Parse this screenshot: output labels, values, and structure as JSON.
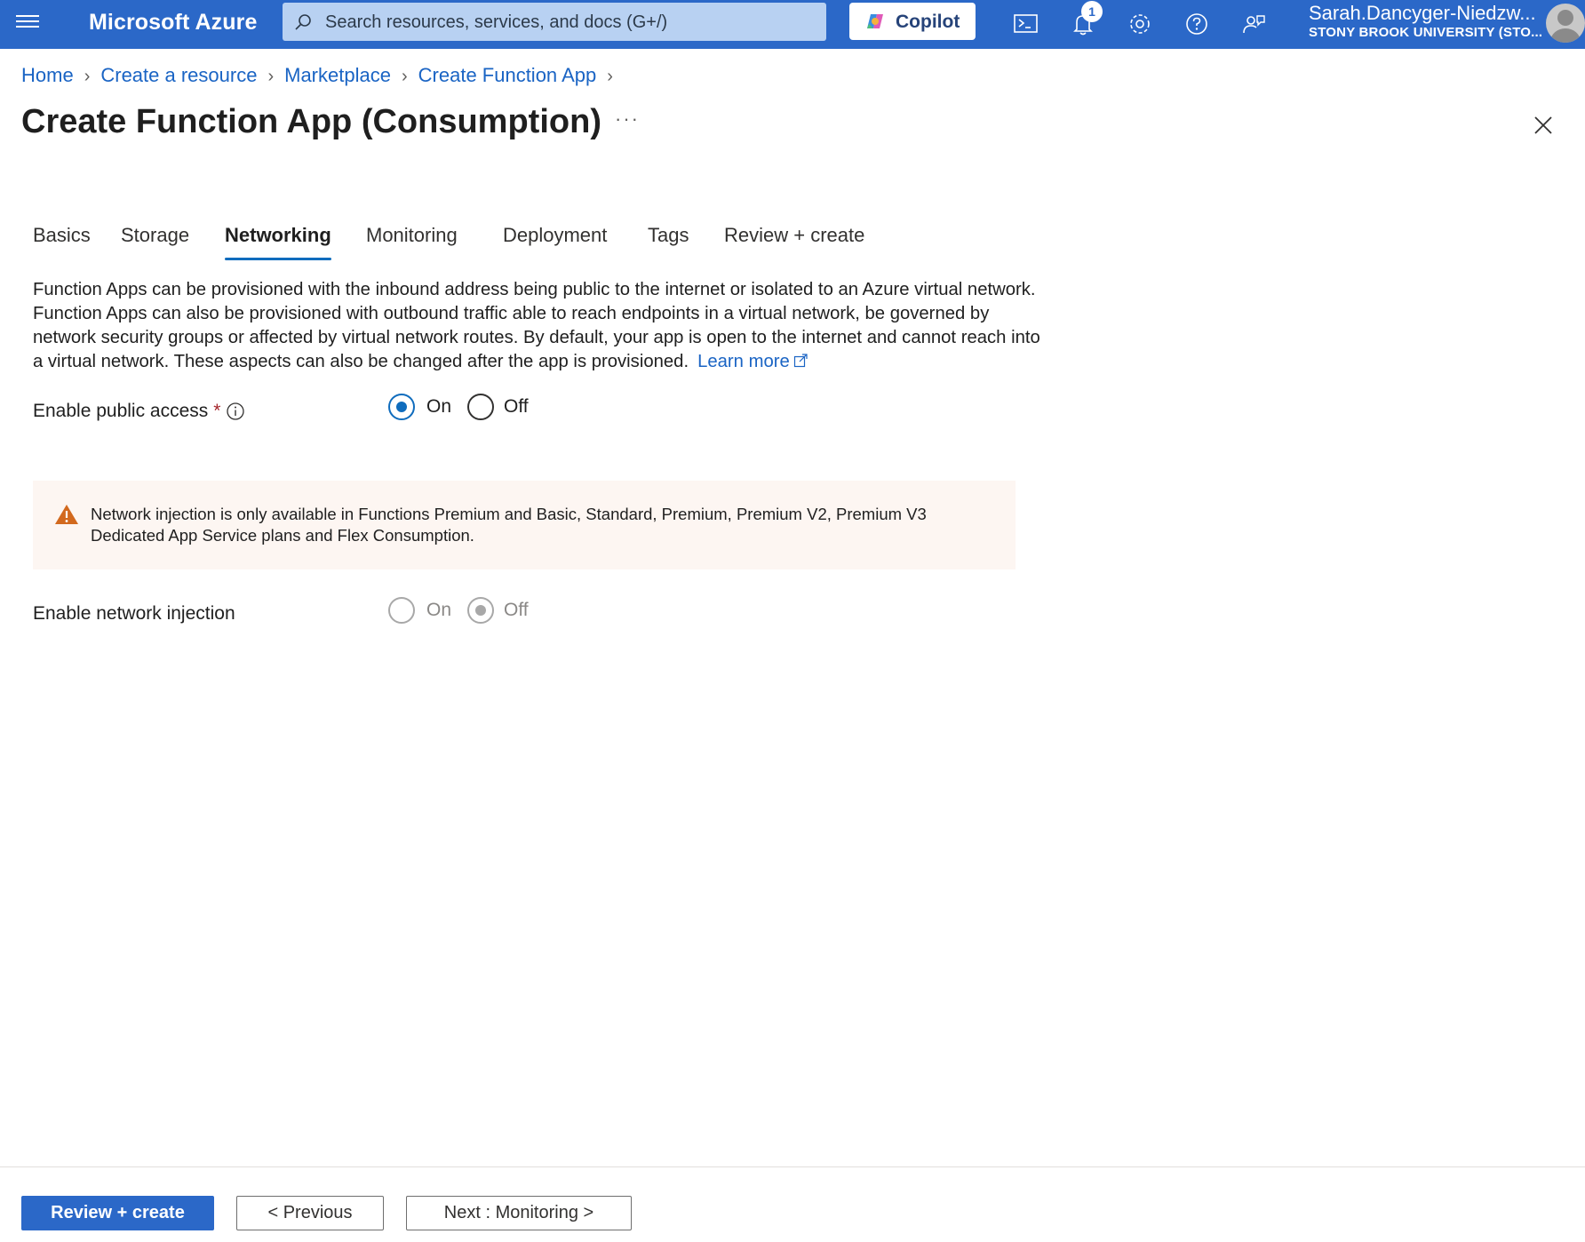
{
  "topbar": {
    "brand": "Microsoft Azure",
    "search_placeholder": "Search resources, services, and docs (G+/)",
    "copilot_label": "Copilot",
    "notification_count": "1",
    "user_name": "Sarah.Dancyger-Niedzw...",
    "user_org": "STONY BROOK UNIVERSITY (STO..."
  },
  "breadcrumb": [
    "Home",
    "Create a resource",
    "Marketplace",
    "Create Function App"
  ],
  "page": {
    "title": "Create Function App (Consumption)",
    "more": "···"
  },
  "tabs": [
    "Basics",
    "Storage",
    "Networking",
    "Monitoring",
    "Deployment",
    "Tags",
    "Review + create"
  ],
  "active_tab": "Networking",
  "description": "Function Apps can be provisioned with the inbound address being public to the internet or isolated to an Azure virtual network. Function Apps can also be provisioned with outbound traffic able to reach endpoints in a virtual network, be governed by network security groups or affected by virtual network routes. By default, your app is open to the internet and cannot reach into a virtual network. These aspects can also be changed after the app is provisioned.",
  "learn_more": "Learn more",
  "public_access": {
    "label": "Enable public access",
    "required_mark": "*",
    "options": [
      "On",
      "Off"
    ],
    "selected": "On"
  },
  "warning": {
    "text": "Network injection is only available in Functions Premium and Basic, Standard, Premium, Premium V2, Premium V3 Dedicated App Service plans and Flex Consumption."
  },
  "network_injection": {
    "label": "Enable network injection",
    "options": [
      "On",
      "Off"
    ],
    "selected": "Off",
    "disabled": true
  },
  "footer": {
    "review_create": "Review + create",
    "previous": "< Previous",
    "next": "Next : Monitoring >"
  },
  "colors": {
    "topbar": "#2b68c8",
    "accent": "#0f6cbd",
    "link": "#1a64c4",
    "warning_bg": "#fdf6f2",
    "warning_icon": "#d2691e"
  }
}
